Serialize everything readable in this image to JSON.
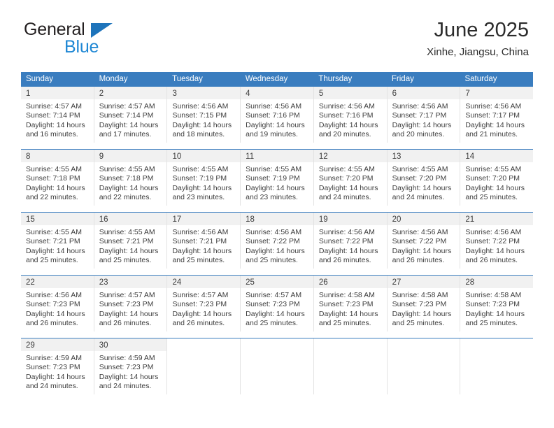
{
  "brand": {
    "name_part1": "General",
    "name_part2": "Blue",
    "triangle_color": "#1e74bb",
    "blue_text_color": "#1e87d4"
  },
  "header": {
    "title": "June 2025",
    "subtitle": "Xinhe, Jiangsu, China"
  },
  "theme": {
    "header_blue": "#3a7dbf",
    "daynum_strip": "#f1f1f1",
    "grid_line": "#e3e3e3",
    "text": "#3d3d3d"
  },
  "calendar": {
    "weekdays": [
      "Sunday",
      "Monday",
      "Tuesday",
      "Wednesday",
      "Thursday",
      "Friday",
      "Saturday"
    ],
    "weeks": [
      [
        {
          "day": "1",
          "sunrise": "Sunrise: 4:57 AM",
          "sunset": "Sunset: 7:14 PM",
          "daylight1": "Daylight: 14 hours",
          "daylight2": "and 16 minutes."
        },
        {
          "day": "2",
          "sunrise": "Sunrise: 4:57 AM",
          "sunset": "Sunset: 7:14 PM",
          "daylight1": "Daylight: 14 hours",
          "daylight2": "and 17 minutes."
        },
        {
          "day": "3",
          "sunrise": "Sunrise: 4:56 AM",
          "sunset": "Sunset: 7:15 PM",
          "daylight1": "Daylight: 14 hours",
          "daylight2": "and 18 minutes."
        },
        {
          "day": "4",
          "sunrise": "Sunrise: 4:56 AM",
          "sunset": "Sunset: 7:16 PM",
          "daylight1": "Daylight: 14 hours",
          "daylight2": "and 19 minutes."
        },
        {
          "day": "5",
          "sunrise": "Sunrise: 4:56 AM",
          "sunset": "Sunset: 7:16 PM",
          "daylight1": "Daylight: 14 hours",
          "daylight2": "and 20 minutes."
        },
        {
          "day": "6",
          "sunrise": "Sunrise: 4:56 AM",
          "sunset": "Sunset: 7:17 PM",
          "daylight1": "Daylight: 14 hours",
          "daylight2": "and 20 minutes."
        },
        {
          "day": "7",
          "sunrise": "Sunrise: 4:56 AM",
          "sunset": "Sunset: 7:17 PM",
          "daylight1": "Daylight: 14 hours",
          "daylight2": "and 21 minutes."
        }
      ],
      [
        {
          "day": "8",
          "sunrise": "Sunrise: 4:55 AM",
          "sunset": "Sunset: 7:18 PM",
          "daylight1": "Daylight: 14 hours",
          "daylight2": "and 22 minutes."
        },
        {
          "day": "9",
          "sunrise": "Sunrise: 4:55 AM",
          "sunset": "Sunset: 7:18 PM",
          "daylight1": "Daylight: 14 hours",
          "daylight2": "and 22 minutes."
        },
        {
          "day": "10",
          "sunrise": "Sunrise: 4:55 AM",
          "sunset": "Sunset: 7:19 PM",
          "daylight1": "Daylight: 14 hours",
          "daylight2": "and 23 minutes."
        },
        {
          "day": "11",
          "sunrise": "Sunrise: 4:55 AM",
          "sunset": "Sunset: 7:19 PM",
          "daylight1": "Daylight: 14 hours",
          "daylight2": "and 23 minutes."
        },
        {
          "day": "12",
          "sunrise": "Sunrise: 4:55 AM",
          "sunset": "Sunset: 7:20 PM",
          "daylight1": "Daylight: 14 hours",
          "daylight2": "and 24 minutes."
        },
        {
          "day": "13",
          "sunrise": "Sunrise: 4:55 AM",
          "sunset": "Sunset: 7:20 PM",
          "daylight1": "Daylight: 14 hours",
          "daylight2": "and 24 minutes."
        },
        {
          "day": "14",
          "sunrise": "Sunrise: 4:55 AM",
          "sunset": "Sunset: 7:20 PM",
          "daylight1": "Daylight: 14 hours",
          "daylight2": "and 25 minutes."
        }
      ],
      [
        {
          "day": "15",
          "sunrise": "Sunrise: 4:55 AM",
          "sunset": "Sunset: 7:21 PM",
          "daylight1": "Daylight: 14 hours",
          "daylight2": "and 25 minutes."
        },
        {
          "day": "16",
          "sunrise": "Sunrise: 4:55 AM",
          "sunset": "Sunset: 7:21 PM",
          "daylight1": "Daylight: 14 hours",
          "daylight2": "and 25 minutes."
        },
        {
          "day": "17",
          "sunrise": "Sunrise: 4:56 AM",
          "sunset": "Sunset: 7:21 PM",
          "daylight1": "Daylight: 14 hours",
          "daylight2": "and 25 minutes."
        },
        {
          "day": "18",
          "sunrise": "Sunrise: 4:56 AM",
          "sunset": "Sunset: 7:22 PM",
          "daylight1": "Daylight: 14 hours",
          "daylight2": "and 25 minutes."
        },
        {
          "day": "19",
          "sunrise": "Sunrise: 4:56 AM",
          "sunset": "Sunset: 7:22 PM",
          "daylight1": "Daylight: 14 hours",
          "daylight2": "and 26 minutes."
        },
        {
          "day": "20",
          "sunrise": "Sunrise: 4:56 AM",
          "sunset": "Sunset: 7:22 PM",
          "daylight1": "Daylight: 14 hours",
          "daylight2": "and 26 minutes."
        },
        {
          "day": "21",
          "sunrise": "Sunrise: 4:56 AM",
          "sunset": "Sunset: 7:22 PM",
          "daylight1": "Daylight: 14 hours",
          "daylight2": "and 26 minutes."
        }
      ],
      [
        {
          "day": "22",
          "sunrise": "Sunrise: 4:56 AM",
          "sunset": "Sunset: 7:23 PM",
          "daylight1": "Daylight: 14 hours",
          "daylight2": "and 26 minutes."
        },
        {
          "day": "23",
          "sunrise": "Sunrise: 4:57 AM",
          "sunset": "Sunset: 7:23 PM",
          "daylight1": "Daylight: 14 hours",
          "daylight2": "and 26 minutes."
        },
        {
          "day": "24",
          "sunrise": "Sunrise: 4:57 AM",
          "sunset": "Sunset: 7:23 PM",
          "daylight1": "Daylight: 14 hours",
          "daylight2": "and 26 minutes."
        },
        {
          "day": "25",
          "sunrise": "Sunrise: 4:57 AM",
          "sunset": "Sunset: 7:23 PM",
          "daylight1": "Daylight: 14 hours",
          "daylight2": "and 25 minutes."
        },
        {
          "day": "26",
          "sunrise": "Sunrise: 4:58 AM",
          "sunset": "Sunset: 7:23 PM",
          "daylight1": "Daylight: 14 hours",
          "daylight2": "and 25 minutes."
        },
        {
          "day": "27",
          "sunrise": "Sunrise: 4:58 AM",
          "sunset": "Sunset: 7:23 PM",
          "daylight1": "Daylight: 14 hours",
          "daylight2": "and 25 minutes."
        },
        {
          "day": "28",
          "sunrise": "Sunrise: 4:58 AM",
          "sunset": "Sunset: 7:23 PM",
          "daylight1": "Daylight: 14 hours",
          "daylight2": "and 25 minutes."
        }
      ],
      [
        {
          "day": "29",
          "sunrise": "Sunrise: 4:59 AM",
          "sunset": "Sunset: 7:23 PM",
          "daylight1": "Daylight: 14 hours",
          "daylight2": "and 24 minutes."
        },
        {
          "day": "30",
          "sunrise": "Sunrise: 4:59 AM",
          "sunset": "Sunset: 7:23 PM",
          "daylight1": "Daylight: 14 hours",
          "daylight2": "and 24 minutes."
        },
        {
          "day": "",
          "sunrise": "",
          "sunset": "",
          "daylight1": "",
          "daylight2": ""
        },
        {
          "day": "",
          "sunrise": "",
          "sunset": "",
          "daylight1": "",
          "daylight2": ""
        },
        {
          "day": "",
          "sunrise": "",
          "sunset": "",
          "daylight1": "",
          "daylight2": ""
        },
        {
          "day": "",
          "sunrise": "",
          "sunset": "",
          "daylight1": "",
          "daylight2": ""
        },
        {
          "day": "",
          "sunrise": "",
          "sunset": "",
          "daylight1": "",
          "daylight2": ""
        }
      ]
    ]
  }
}
